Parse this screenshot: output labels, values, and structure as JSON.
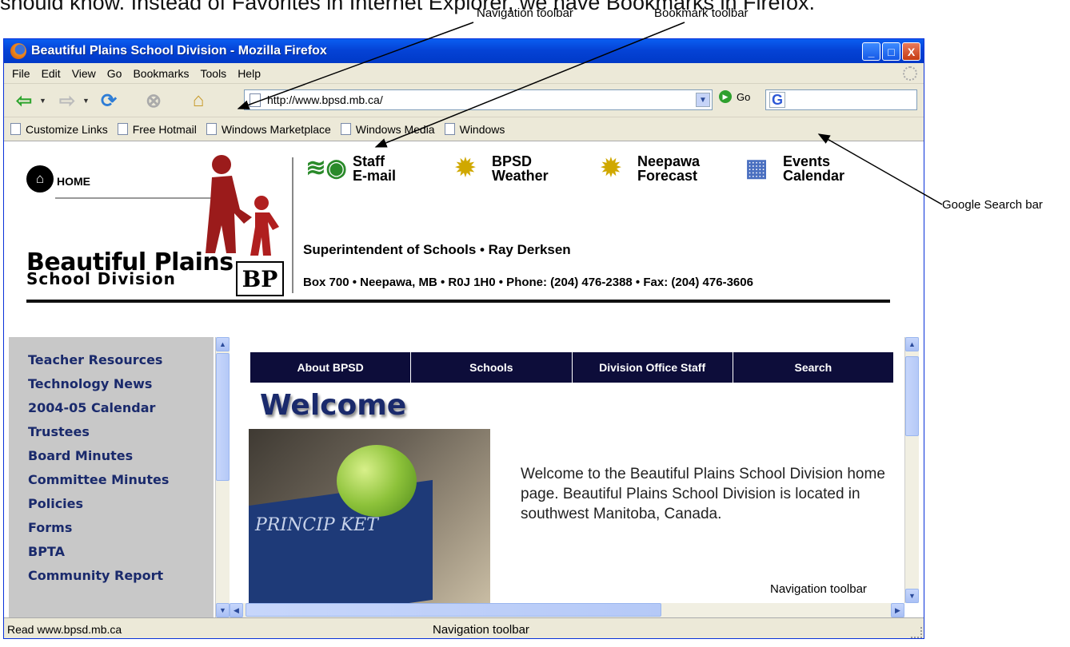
{
  "intro_sentence": "should know. Instead of Favorites in Internet Explorer, we have Bookmarks in Firefox.",
  "annotations": {
    "navigation_toolbar": "Navigation toolbar",
    "bookmark_toolbar": "Bookmark toolbar",
    "google_search_bar": "Google Search bar"
  },
  "window": {
    "title": "Beautiful Plains School Division - Mozilla Firefox",
    "controls": {
      "minimize": "_",
      "maximize": "□",
      "close": "X"
    }
  },
  "menu": [
    "File",
    "Edit",
    "View",
    "Go",
    "Bookmarks",
    "Tools",
    "Help"
  ],
  "navbar": {
    "url": "http://www.bpsd.mb.ca/",
    "go_label": "Go",
    "search_logo": "G"
  },
  "bookmarks": [
    "Customize Links",
    "Free Hotmail",
    "Windows Marketplace",
    "Windows Media",
    "Windows"
  ],
  "page": {
    "home_label": "HOME",
    "logo_line1": "Beautiful Plains",
    "logo_line2": "School Division",
    "logo_mark": "BP",
    "quick_links": [
      {
        "line1": "Staff",
        "line2": "E-mail",
        "icon": "email-icon"
      },
      {
        "line1": "BPSD",
        "line2": "Weather",
        "icon": "sun-icon"
      },
      {
        "line1": "Neepawa",
        "line2": "Forecast",
        "icon": "sun-icon"
      },
      {
        "line1": "Events",
        "line2": "Calendar",
        "icon": "calendar-icon"
      }
    ],
    "superintendent": "Superintendent of Schools • Ray Derksen",
    "address": "Box 700 • Neepawa, MB • R0J 1H0 • Phone: (204) 476-2388 • Fax: (204) 476-3606",
    "left_links": [
      "Teacher Resources",
      "Technology News",
      "2004-05 Calendar",
      "Trustees",
      "Board Minutes",
      "Committee Minutes",
      "Policies",
      "Forms",
      "BPTA",
      "Community Report"
    ],
    "nav_tabs": [
      "About BPSD",
      "Schools",
      "Division Office Staff",
      "Search"
    ],
    "welcome_heading": "Welcome",
    "welcome_text": "Welcome to the Beautiful Plains School Division home page. Beautiful Plains School Division is located in southwest Manitoba, Canada."
  },
  "status": {
    "text": "Read www.bpsd.mb.ca"
  }
}
